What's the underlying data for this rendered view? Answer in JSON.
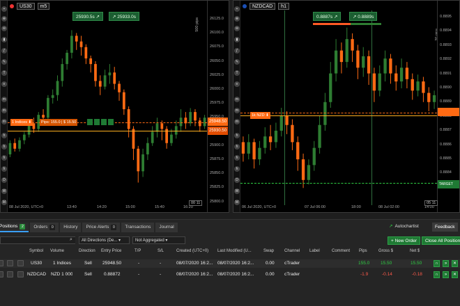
{
  "colors": {
    "bull": "#2e7d32",
    "bear": "#ff6a13",
    "accent": "#3aa0ff",
    "positive": "#2fcf44",
    "negative": "#ff5a4a"
  },
  "chart_left": {
    "symbol": "US30",
    "timeframe": "m5",
    "sell_button": "25930.5s",
    "buy_button": "25933.0s",
    "y_axis_ticks": [
      "26125.0",
      "26100.0",
      "26075.0",
      "26050.0",
      "26025.0",
      "26000.0",
      "25975.0",
      "25950.0",
      "25925.0",
      "25900.0",
      "25875.0",
      "25850.0",
      "25825.0",
      "25800.0"
    ],
    "x_axis_labels": [
      "08 Jul 2020, UTC+0",
      "13:40",
      "14:20",
      "15:00",
      "15:40",
      "16:20"
    ],
    "pips_scale": "500 pips",
    "position_label": "1 Indices",
    "position_info": "Pips: 155.0 | $ 15.50",
    "entry_price_tag": "25948.50",
    "current_price_tag": "25930.50",
    "corner_badge": "00 11",
    "candles": [
      [
        25880,
        25900,
        25875,
        25905
      ],
      [
        25900,
        25890,
        25885,
        25908
      ],
      [
        25890,
        25905,
        25885,
        25910
      ],
      [
        25905,
        25915,
        25898,
        25920
      ],
      [
        25915,
        25935,
        25910,
        25940
      ],
      [
        25935,
        25925,
        25918,
        25945
      ],
      [
        25925,
        25950,
        25920,
        25955
      ],
      [
        25950,
        25945,
        25938,
        25960
      ],
      [
        25945,
        25980,
        25940,
        25985
      ],
      [
        25980,
        25985,
        25970,
        25995
      ],
      [
        25985,
        26010,
        25975,
        26020
      ],
      [
        26010,
        26040,
        26000,
        26050
      ],
      [
        26040,
        26060,
        26030,
        26065
      ],
      [
        26060,
        26090,
        26050,
        26100
      ],
      [
        26090,
        26080,
        26065,
        26095
      ],
      [
        26080,
        26070,
        26055,
        26090
      ],
      [
        26070,
        26050,
        26040,
        26075
      ],
      [
        26050,
        26040,
        26025,
        26055
      ],
      [
        26040,
        26010,
        26000,
        26045
      ],
      [
        26010,
        26000,
        25985,
        26020
      ],
      [
        26000,
        26020,
        25995,
        26030
      ],
      [
        26020,
        26025,
        26005,
        26040
      ],
      [
        26025,
        26005,
        25995,
        26035
      ],
      [
        26005,
        25990,
        25975,
        26010
      ],
      [
        25990,
        25960,
        25950,
        25995
      ],
      [
        25960,
        25925,
        25910,
        25965
      ],
      [
        25925,
        25890,
        25870,
        25930
      ],
      [
        25890,
        25850,
        25830,
        25895
      ],
      [
        25850,
        25880,
        25840,
        25890
      ],
      [
        25880,
        25900,
        25870,
        25910
      ],
      [
        25900,
        25920,
        25895,
        25930
      ],
      [
        25920,
        25935,
        25910,
        25945
      ],
      [
        25935,
        25925,
        25905,
        25940
      ],
      [
        25925,
        25900,
        25890,
        25930
      ],
      [
        25900,
        25915,
        25895,
        25925
      ],
      [
        25915,
        25930,
        25908,
        25940
      ],
      [
        25930,
        25945,
        25920,
        25960
      ],
      [
        25945,
        25935,
        25925,
        25955
      ],
      [
        25935,
        25955,
        25930,
        25962
      ],
      [
        25955,
        25940,
        25930,
        25960
      ],
      [
        25940,
        25930,
        25920,
        25945
      ],
      [
        25930,
        25945,
        25925,
        25950
      ]
    ]
  },
  "chart_right": {
    "symbol": "NZDCAD",
    "timeframe": "h1",
    "sell_button": "0.8887s",
    "buy_button": "0.8889s",
    "y_axis_ticks": [
      "0.8895",
      "0.8894",
      "0.8893",
      "0.8892",
      "0.8891",
      "0.8890",
      "0.8889",
      "0.8888",
      "0.8887",
      "0.8886",
      "0.8885",
      "0.8884",
      "0.8883"
    ],
    "x_axis_labels": [
      "06 Jul 2020, UTC+0",
      "07 Jul 06:00",
      "18:00",
      "08 Jul 02:00",
      "14:00"
    ],
    "pips_scale": "20 pips",
    "position_label": "1k NZD",
    "target_label": "TARGET",
    "corner_badge": "05 11",
    "candles": [
      [
        0.88845,
        0.88835,
        0.88828,
        0.8885
      ],
      [
        0.88835,
        0.88845,
        0.8883,
        0.88852
      ],
      [
        0.88845,
        0.8883,
        0.88822,
        0.88848
      ],
      [
        0.8883,
        0.8884,
        0.88825,
        0.88846
      ],
      [
        0.8884,
        0.8885,
        0.88835,
        0.88858
      ],
      [
        0.8885,
        0.88845,
        0.88838,
        0.8886
      ],
      [
        0.88845,
        0.88855,
        0.8884,
        0.88862
      ],
      [
        0.88855,
        0.88868,
        0.8885,
        0.88875
      ],
      [
        0.88868,
        0.8886,
        0.88852,
        0.88872
      ],
      [
        0.8886,
        0.88845,
        0.88838,
        0.88865
      ],
      [
        0.88845,
        0.8883,
        0.8882,
        0.8885
      ],
      [
        0.8883,
        0.88812,
        0.88805,
        0.88835
      ],
      [
        0.88812,
        0.88825,
        0.88808,
        0.8883
      ],
      [
        0.88825,
        0.8884,
        0.8882,
        0.88846
      ],
      [
        0.8884,
        0.8886,
        0.88835,
        0.88868
      ],
      [
        0.8886,
        0.8888,
        0.88855,
        0.88888
      ],
      [
        0.8888,
        0.88905,
        0.88875,
        0.88915
      ],
      [
        0.88905,
        0.88925,
        0.88898,
        0.88935
      ],
      [
        0.88925,
        0.88915,
        0.88905,
        0.88932
      ],
      [
        0.88915,
        0.88935,
        0.8891,
        0.88945
      ],
      [
        0.88935,
        0.88925,
        0.88915,
        0.8894
      ],
      [
        0.88925,
        0.8891,
        0.889,
        0.8893
      ],
      [
        0.8891,
        0.8892,
        0.88902,
        0.88928
      ],
      [
        0.8892,
        0.88905,
        0.88895,
        0.88925
      ],
      [
        0.88905,
        0.8889,
        0.8888,
        0.8891
      ],
      [
        0.8889,
        0.88905,
        0.88885,
        0.88912
      ],
      [
        0.88905,
        0.88918,
        0.88898,
        0.88925
      ],
      [
        0.88918,
        0.88905,
        0.88896,
        0.88922
      ],
      [
        0.88905,
        0.88898,
        0.8889,
        0.88912
      ],
      [
        0.88898,
        0.8891,
        0.88892,
        0.88918
      ],
      [
        0.8891,
        0.889,
        0.88892,
        0.88915
      ],
      [
        0.889,
        0.8889,
        0.88882,
        0.88905
      ],
      [
        0.8889,
        0.88898,
        0.88885,
        0.88904
      ],
      [
        0.88898,
        0.88888,
        0.8888,
        0.88902
      ],
      [
        0.88888,
        0.8888,
        0.88872,
        0.88893
      ],
      [
        0.8888,
        0.88886,
        0.88874,
        0.8889
      ]
    ]
  },
  "positions_panel": {
    "tabs": [
      {
        "label": "Positions",
        "count": "2"
      },
      {
        "label": "Orders",
        "count": "0"
      },
      {
        "label": "History",
        "count": ""
      },
      {
        "label": "Price Alerts",
        "count": "0"
      },
      {
        "label": "Transactions",
        "count": ""
      },
      {
        "label": "Journal",
        "count": ""
      }
    ],
    "autochartist": "Autochartist",
    "feedback": "Feedback",
    "filter_direction": "All Directions (De...",
    "filter_aggregation": "Not Aggregated",
    "new_order": "New Order",
    "close_all": "Close All Positions",
    "columns": [
      "Symbol",
      "Volume",
      "Direction",
      "Entry Price",
      "T/P",
      "S/L",
      "Created (UTC+0)",
      "Last Modified (U...",
      "Swap",
      "Channel",
      "Label",
      "Comment",
      "Pips",
      "Gross $",
      "Net $"
    ],
    "rows": [
      {
        "symbol": "US30",
        "volume": "1 Indices",
        "direction": "Sell",
        "entry": "25948.50",
        "tp": "-",
        "sl": "-",
        "created": "08/07/2020 16:2...",
        "modified": "08/07/2020 16:2...",
        "swap": "0.00",
        "channel": "cTrader",
        "label": "",
        "comment": "",
        "pips": "155.0",
        "gross": "15.50",
        "net": "15.50",
        "sign": "pos"
      },
      {
        "symbol": "NZDCAD",
        "volume": "NZD 1 000",
        "direction": "Sell",
        "entry": "0.88872",
        "tp": "-",
        "sl": "-",
        "created": "08/07/2020 16:2...",
        "modified": "08/07/2020 16:2...",
        "swap": "0.00",
        "channel": "cTrader",
        "label": "",
        "comment": "",
        "pips": "-1.9",
        "gross": "-0.14",
        "net": "-0.18",
        "sign": "neg"
      }
    ]
  }
}
